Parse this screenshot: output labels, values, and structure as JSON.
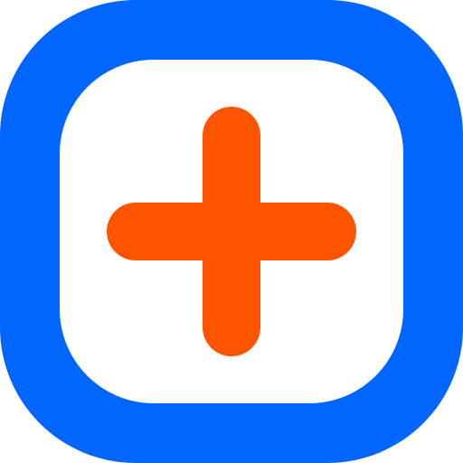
{
  "icon": {
    "name": "add-plus-icon",
    "colors": {
      "frame": "#0066FF",
      "interior": "#FFFFFF",
      "plus": "#FF5500"
    }
  }
}
